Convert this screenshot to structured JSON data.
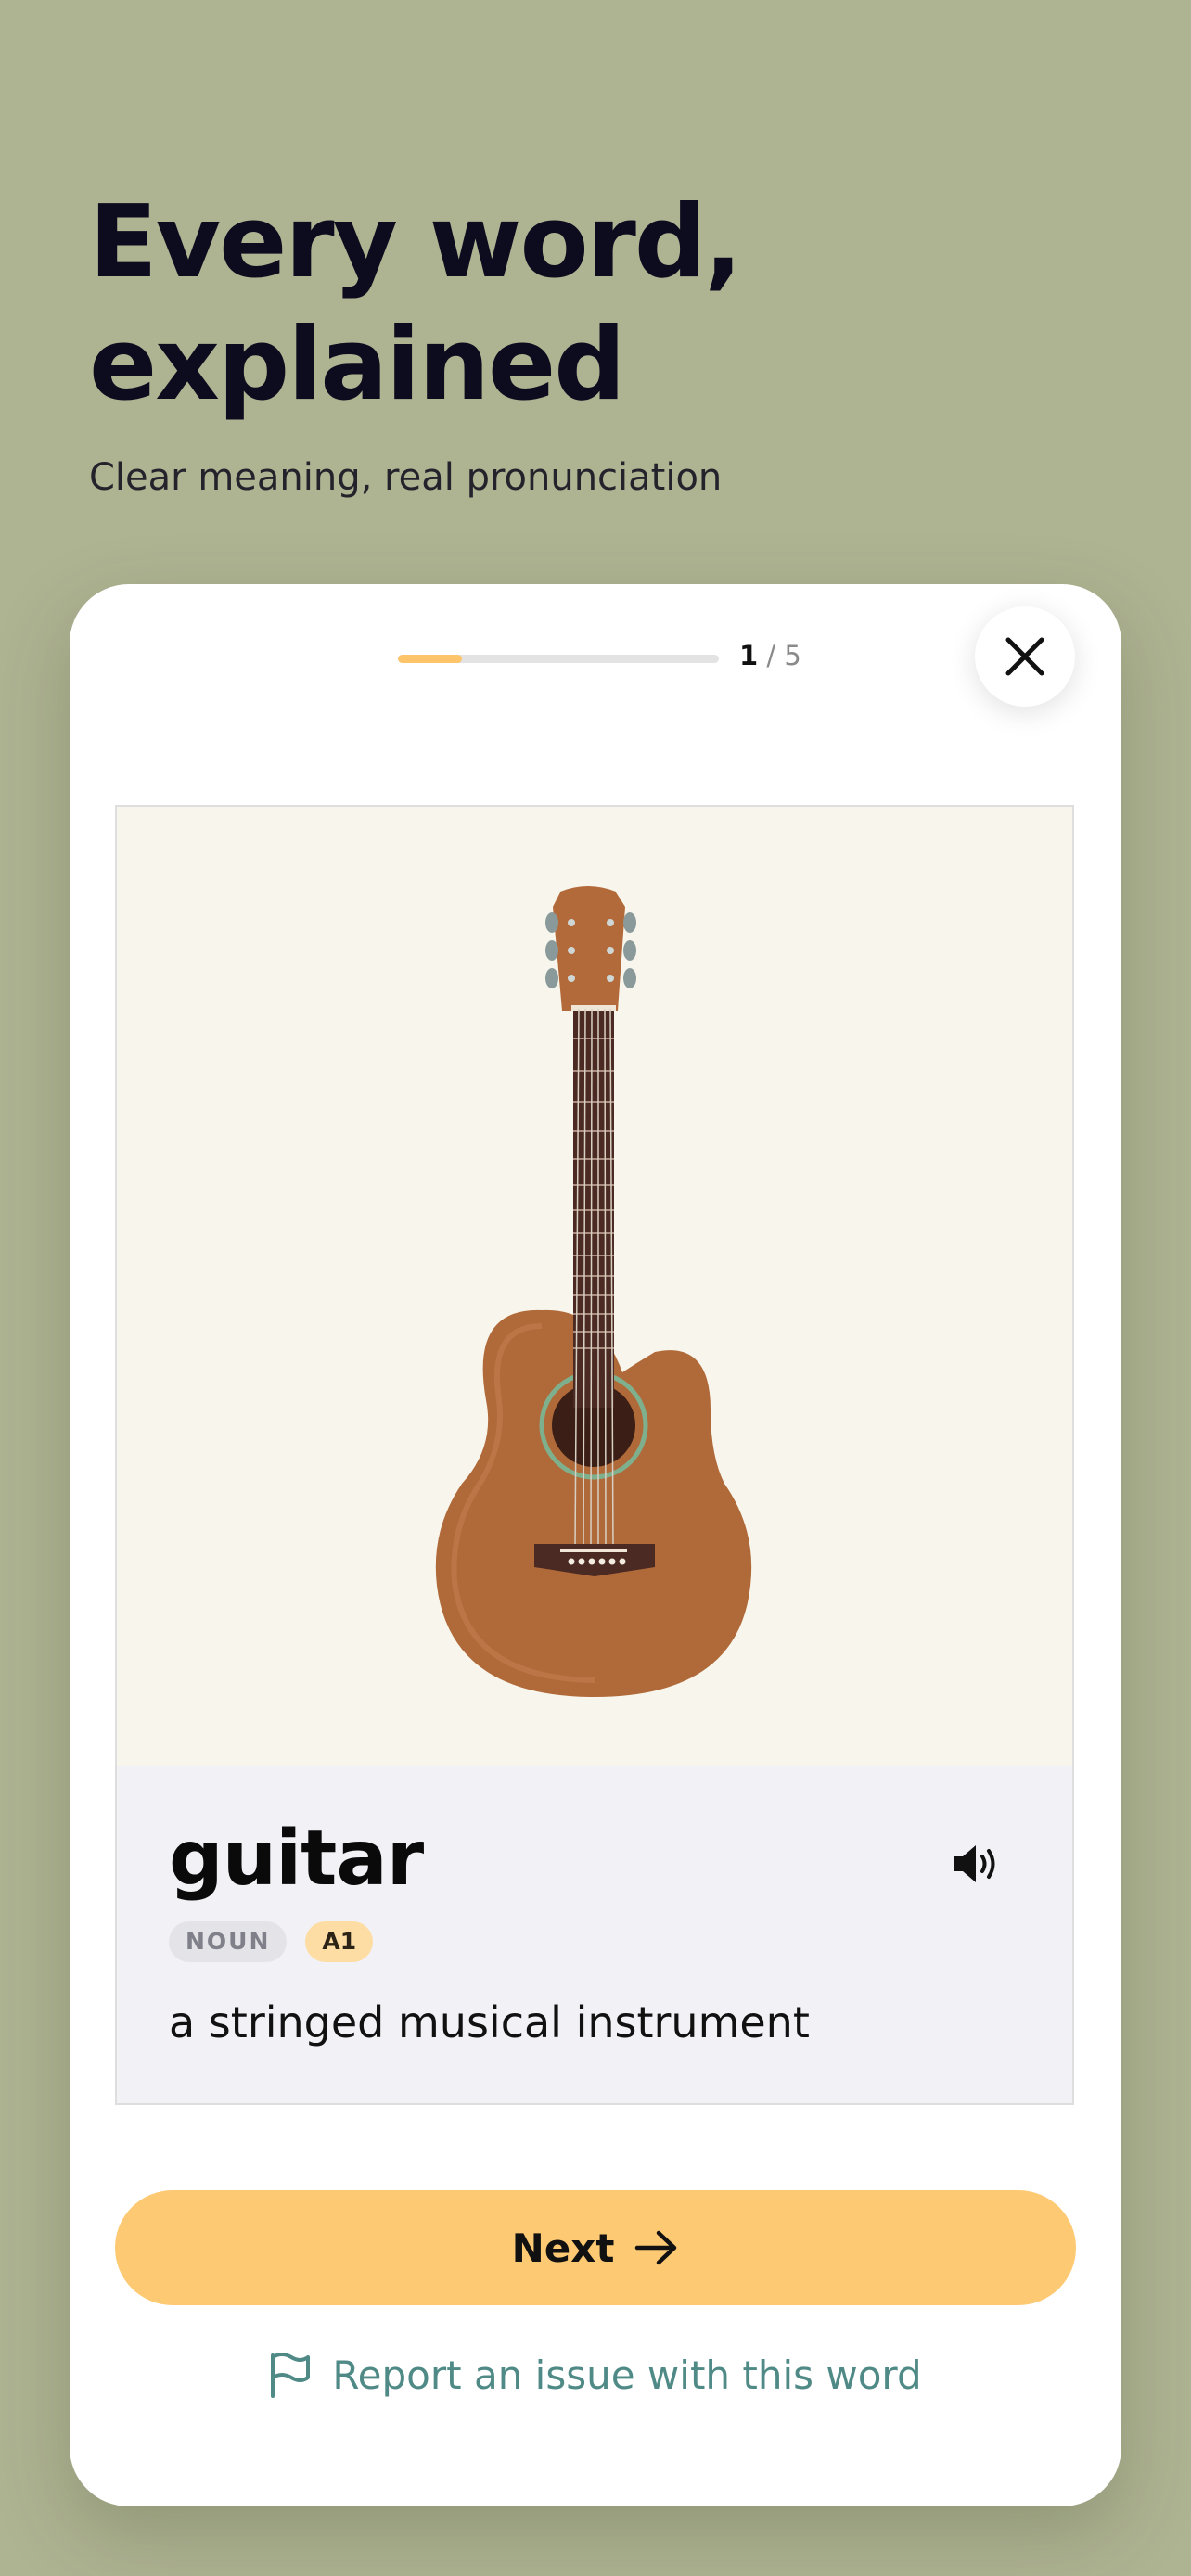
{
  "hero": {
    "title_line1": "Every word,",
    "title_line2": "explained",
    "subtitle": "Clear meaning, real pronunciation"
  },
  "progress": {
    "current": "1",
    "separator": " / ",
    "total": "5",
    "fraction": 0.2
  },
  "close": {
    "icon": "close-icon"
  },
  "word_card": {
    "image": "guitar-illustration",
    "word": "guitar",
    "part_of_speech": "NOUN",
    "level": "A1",
    "definition": "a stringed musical instrument",
    "speaker_icon": "speaker-icon"
  },
  "actions": {
    "next_label": "Next",
    "next_icon": "arrow-right-icon",
    "report_label": "Report an issue with this word",
    "report_icon": "flag-icon"
  },
  "colors": {
    "background": "#aeb392",
    "accent": "#fec973",
    "progress_fill": "#fdc46a",
    "link": "#4f8a86",
    "card": "#ffffff"
  }
}
